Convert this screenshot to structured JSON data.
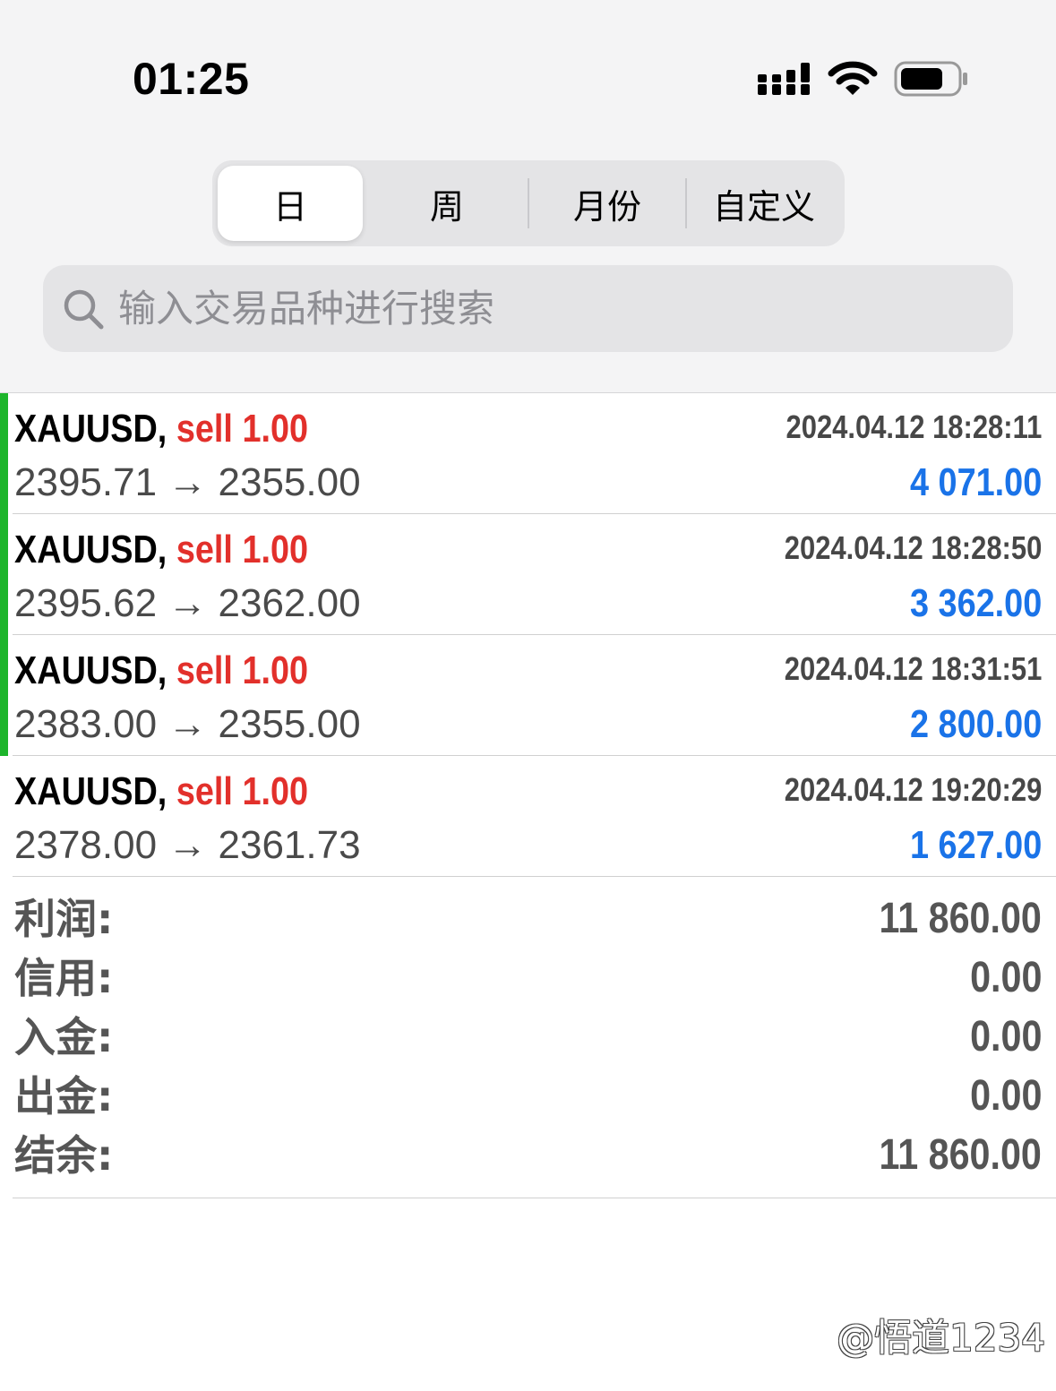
{
  "status_bar": {
    "time": "01:25",
    "icons": [
      "cellular-signal-icon",
      "wifi-icon",
      "battery-icon"
    ]
  },
  "period_tabs": {
    "tabs": [
      {
        "label": "日",
        "selected": true
      },
      {
        "label": "周",
        "selected": false
      },
      {
        "label": "月份",
        "selected": false
      },
      {
        "label": "自定义",
        "selected": false
      }
    ]
  },
  "search": {
    "placeholder": "输入交易品种进行搜索",
    "icon": "search-icon"
  },
  "trades": [
    {
      "symbol": "XAUUSD,",
      "side": "sell 1.00",
      "datetime": "2024.04.12 18:28:11",
      "prices": "2395.71 → 2355.00",
      "profit": "4 071.00"
    },
    {
      "symbol": "XAUUSD,",
      "side": "sell 1.00",
      "datetime": "2024.04.12 18:28:50",
      "prices": "2395.62 → 2362.00",
      "profit": "3 362.00"
    },
    {
      "symbol": "XAUUSD,",
      "side": "sell 1.00",
      "datetime": "2024.04.12 18:31:51",
      "prices": "2383.00 → 2355.00",
      "profit": "2 800.00"
    },
    {
      "symbol": "XAUUSD,",
      "side": "sell 1.00",
      "datetime": "2024.04.12 19:20:29",
      "prices": "2378.00 → 2361.73",
      "profit": "1 627.00"
    }
  ],
  "summary": [
    {
      "label": "利润:",
      "value": "11 860.00"
    },
    {
      "label": "信用:",
      "value": "0.00"
    },
    {
      "label": "入金:",
      "value": "0.00"
    },
    {
      "label": "出金:",
      "value": "0.00"
    },
    {
      "label": "结余:",
      "value": "11 860.00"
    }
  ],
  "watermark": "@悟道1234",
  "colors": {
    "sell": "#e2302b",
    "profit": "#1a73e8",
    "indicator_bar": "#1db52b",
    "header_bg": "#f4f4f5"
  }
}
